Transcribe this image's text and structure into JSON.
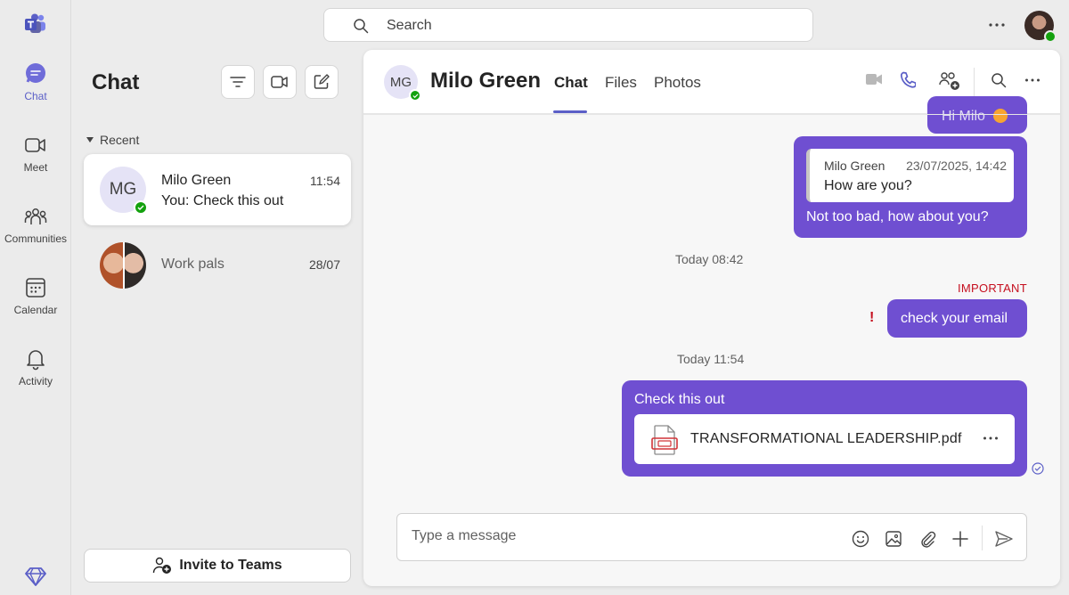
{
  "rail": {
    "items": [
      {
        "label": "Chat"
      },
      {
        "label": "Meet"
      },
      {
        "label": "Communities"
      },
      {
        "label": "Calendar"
      },
      {
        "label": "Activity"
      }
    ]
  },
  "search": {
    "placeholder": "Search"
  },
  "chat_list": {
    "title": "Chat",
    "section_label": "Recent",
    "conversations": [
      {
        "initials": "MG",
        "name": "Milo Green",
        "preview": "You: Check this out",
        "time": "11:54"
      },
      {
        "name": "Work pals",
        "time": "28/07"
      }
    ],
    "invite_label": "Invite to Teams"
  },
  "conversation": {
    "contact_initials": "MG",
    "contact_name": "Milo Green",
    "tabs": [
      "Chat",
      "Files",
      "Photos"
    ],
    "messages": {
      "partial_top": "Hi Milo",
      "reply": {
        "quote_author": "Milo Green",
        "quote_date": "23/07/2025, 14:42",
        "quote_text": "How are you?",
        "text": "Not too bad, how about you?"
      },
      "stamp1": "Today 08:42",
      "important_label": "IMPORTANT",
      "important_mark": "!",
      "important_text": "check your email",
      "stamp2": "Today 11:54",
      "file_message": {
        "text": "Check this out",
        "file_name": "TRANSFORMATIONAL LEADERSHIP.pdf"
      }
    },
    "composer_placeholder": "Type a message"
  },
  "colors": {
    "accent": "#5b5fc7",
    "bubble": "#6f4fd1",
    "important": "#c50f1f",
    "presence": "#13a10e"
  }
}
